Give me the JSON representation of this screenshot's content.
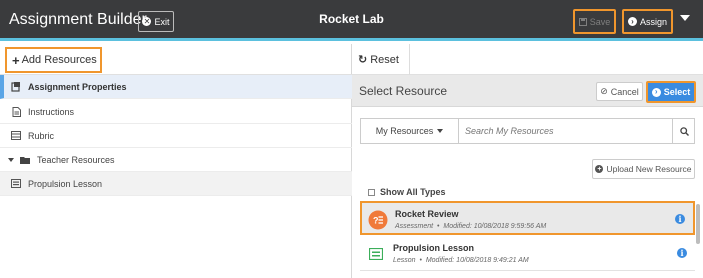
{
  "topbar": {
    "app_title": "Assignment Builder",
    "exit_label": "Exit",
    "project_title": "Rocket Lab",
    "save_label": "Save",
    "assign_label": "Assign"
  },
  "left_panel": {
    "add_label": "Add Resources",
    "items": [
      {
        "label": "Assignment Properties",
        "icon": "properties-icon"
      },
      {
        "label": "Instructions",
        "icon": "document-icon"
      },
      {
        "label": "Rubric",
        "icon": "list-icon"
      },
      {
        "label": "Teacher Resources",
        "icon": "folder-icon"
      },
      {
        "label": "Propulsion Lesson",
        "icon": "lesson-icon"
      }
    ]
  },
  "right_panel": {
    "reset_label": "Reset",
    "select_title": "Select Resource",
    "cancel_label": "Cancel",
    "select_label": "Select",
    "filter_label": "My Resources",
    "search_placeholder": "Search My Resources",
    "upload_label": "Upload New Resource",
    "show_all_label": "Show All Types",
    "resources": [
      {
        "title": "Rocket Review",
        "type": "Assessment",
        "modified": "Modified: 10/08/2018 9:59:56 AM",
        "icon": "assessment-icon",
        "icon_color": "#f07a3a",
        "selected": true
      },
      {
        "title": "Propulsion Lesson",
        "type": "Lesson",
        "modified": "Modified: 10/08/2018 9:49:21 AM",
        "icon": "lesson-icon",
        "icon_color": "#3cae5a",
        "selected": false
      }
    ]
  },
  "colors": {
    "topbar": "#3a3b3d",
    "accent": "#5bc0de",
    "highlight_outline": "#f0962d",
    "primary_button": "#3a8be0"
  }
}
